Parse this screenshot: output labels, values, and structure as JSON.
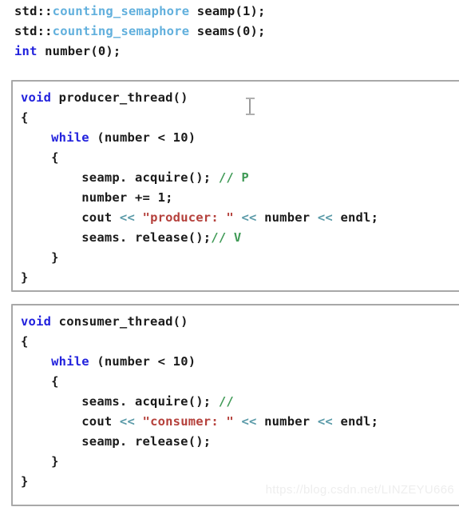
{
  "declarations": {
    "lines": [
      {
        "tokens": [
          {
            "t": "std::",
            "c": "plain"
          },
          {
            "t": "counting_semaphore",
            "c": "type"
          },
          {
            "t": " seamp(1);",
            "c": "plain"
          }
        ]
      },
      {
        "tokens": [
          {
            "t": "std::",
            "c": "plain"
          },
          {
            "t": "counting_semaphore",
            "c": "type"
          },
          {
            "t": " seams(0);",
            "c": "plain"
          }
        ]
      },
      {
        "tokens": [
          {
            "t": "int",
            "c": "kw"
          },
          {
            "t": " number(0);",
            "c": "plain"
          }
        ]
      }
    ]
  },
  "producer_block": {
    "title": "producer_thread",
    "lines": [
      {
        "tokens": [
          {
            "t": "void",
            "c": "kw"
          },
          {
            "t": " producer_thread()",
            "c": "plain"
          }
        ]
      },
      {
        "tokens": [
          {
            "t": "{",
            "c": "plain"
          }
        ]
      },
      {
        "tokens": [
          {
            "t": "    ",
            "c": "plain"
          },
          {
            "t": "while",
            "c": "kw"
          },
          {
            "t": " (number < 10)",
            "c": "plain"
          }
        ]
      },
      {
        "tokens": [
          {
            "t": "    {",
            "c": "plain"
          }
        ]
      },
      {
        "tokens": [
          {
            "t": "        seamp. acquire(); ",
            "c": "plain"
          },
          {
            "t": "// P",
            "c": "cmt"
          }
        ]
      },
      {
        "tokens": [
          {
            "t": "        number += 1;",
            "c": "plain"
          }
        ]
      },
      {
        "tokens": [
          {
            "t": "        cout ",
            "c": "plain"
          },
          {
            "t": "<<",
            "c": "op"
          },
          {
            "t": " ",
            "c": "plain"
          },
          {
            "t": "\"producer: \"",
            "c": "str"
          },
          {
            "t": " ",
            "c": "plain"
          },
          {
            "t": "<<",
            "c": "op"
          },
          {
            "t": " number ",
            "c": "plain"
          },
          {
            "t": "<<",
            "c": "op"
          },
          {
            "t": " endl;",
            "c": "plain"
          }
        ]
      },
      {
        "tokens": [
          {
            "t": "        seams. release();",
            "c": "plain"
          },
          {
            "t": "// V",
            "c": "cmt"
          }
        ]
      },
      {
        "tokens": [
          {
            "t": "    }",
            "c": "plain"
          }
        ]
      },
      {
        "tokens": [
          {
            "t": "}",
            "c": "plain"
          }
        ]
      }
    ]
  },
  "consumer_block": {
    "title": "consumer_thread",
    "lines": [
      {
        "tokens": [
          {
            "t": "void",
            "c": "kw"
          },
          {
            "t": " consumer_thread()",
            "c": "plain"
          }
        ]
      },
      {
        "tokens": [
          {
            "t": "{",
            "c": "plain"
          }
        ]
      },
      {
        "tokens": [
          {
            "t": "    ",
            "c": "plain"
          },
          {
            "t": "while",
            "c": "kw"
          },
          {
            "t": " (number < 10)",
            "c": "plain"
          }
        ]
      },
      {
        "tokens": [
          {
            "t": "    {",
            "c": "plain"
          }
        ]
      },
      {
        "tokens": [
          {
            "t": "        seams. acquire(); ",
            "c": "plain"
          },
          {
            "t": "//",
            "c": "cmt"
          }
        ]
      },
      {
        "tokens": [
          {
            "t": "        cout ",
            "c": "plain"
          },
          {
            "t": "<<",
            "c": "op"
          },
          {
            "t": " ",
            "c": "plain"
          },
          {
            "t": "\"consumer: \"",
            "c": "str"
          },
          {
            "t": " ",
            "c": "plain"
          },
          {
            "t": "<<",
            "c": "op"
          },
          {
            "t": " number ",
            "c": "plain"
          },
          {
            "t": "<<",
            "c": "op"
          },
          {
            "t": " endl;",
            "c": "plain"
          }
        ]
      },
      {
        "tokens": [
          {
            "t": "        seamp. release();",
            "c": "plain"
          }
        ]
      },
      {
        "tokens": [
          {
            "t": "    }",
            "c": "plain"
          }
        ]
      },
      {
        "tokens": [
          {
            "t": "}",
            "c": "plain"
          }
        ]
      }
    ]
  },
  "watermark": {
    "text": "https://blog.csdn.net/LINZEYU666"
  },
  "colors": {
    "keyword": "#2222dd",
    "type": "#62b0dd",
    "string": "#b5413c",
    "comment": "#3f9a56",
    "operator": "#5a9aa8",
    "plain": "#1a1a1a",
    "box_border": "#a8a8a8",
    "background": "#ffffff",
    "watermark": "#eeeeee"
  }
}
